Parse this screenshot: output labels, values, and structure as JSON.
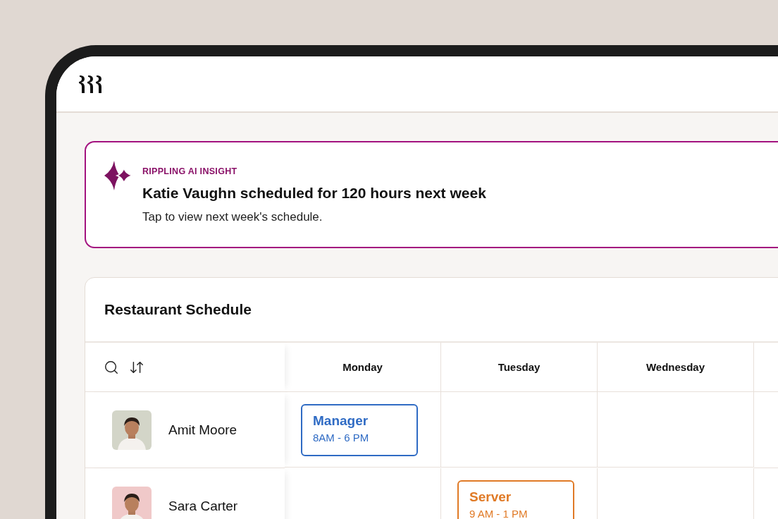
{
  "insight": {
    "label": "RIPPLING AI INSIGHT",
    "title": "Katie Vaughn scheduled for 120 hours next week",
    "subtitle": "Tap to view next week's schedule."
  },
  "schedule": {
    "title": "Restaurant Schedule",
    "days": [
      "Monday",
      "Tuesday",
      "Wednesday"
    ],
    "rows": [
      {
        "name": "Amit Moore",
        "cells": [
          {
            "kind": "shift",
            "role": "Manager",
            "time": "8AM - 6 PM",
            "color": "#2f6bc4"
          },
          {
            "kind": "empty"
          },
          {
            "kind": "empty"
          }
        ]
      },
      {
        "name": "Sara Carter",
        "cells": [
          {
            "kind": "empty"
          },
          {
            "kind": "shift",
            "role": "Server",
            "time": "9 AM - 1 PM",
            "color": "#e07a26"
          },
          {
            "kind": "empty"
          }
        ]
      }
    ]
  }
}
